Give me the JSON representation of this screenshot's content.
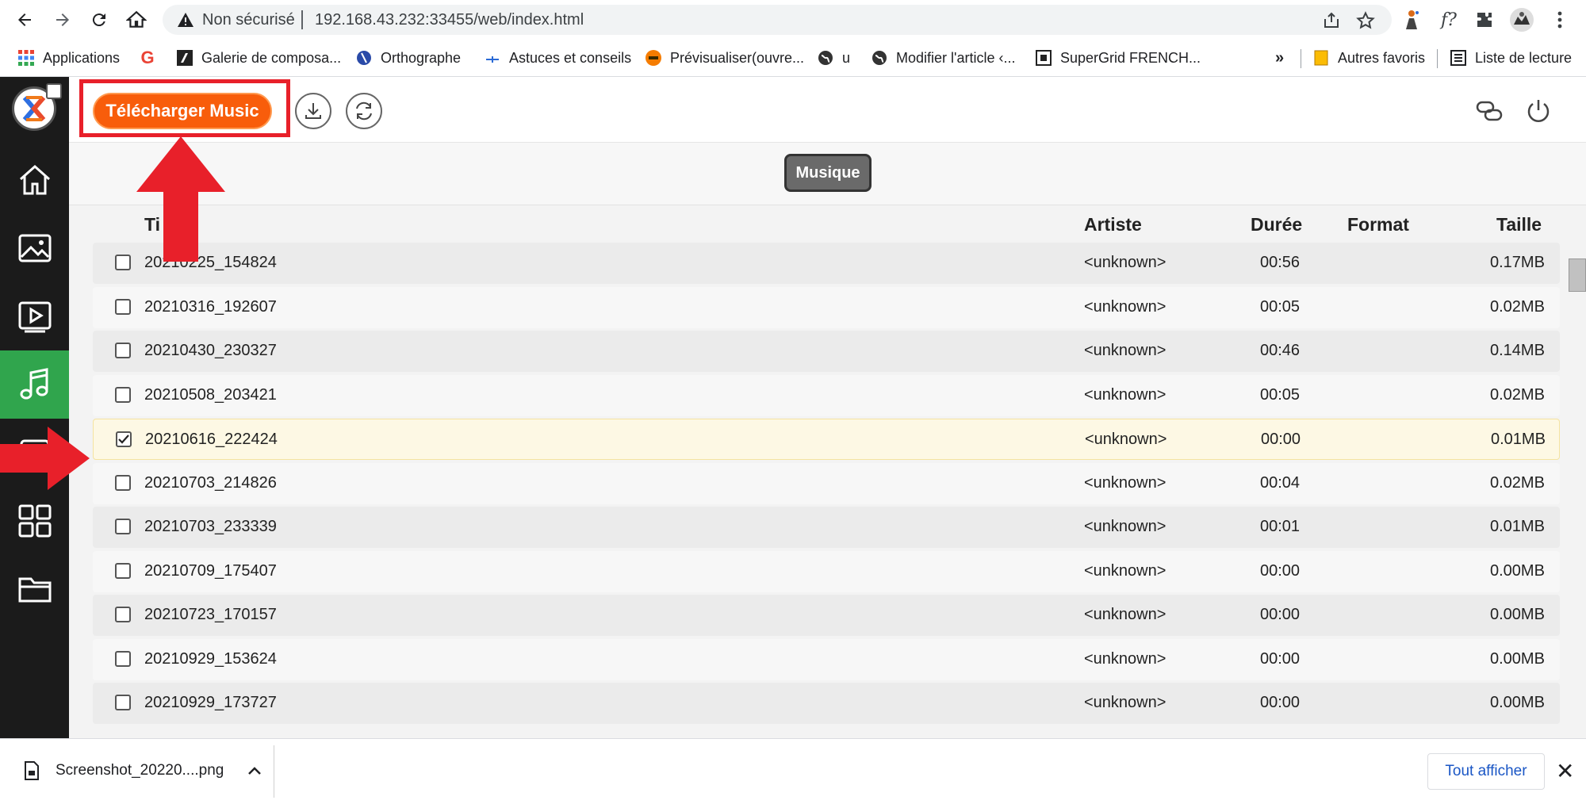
{
  "browser": {
    "security_label": "Non sécurisé",
    "url": "192.168.43.232:33455/web/index.html"
  },
  "bookmarks": [
    {
      "label": "Applications",
      "icon": "apps-grid-icon"
    },
    {
      "label": "",
      "icon": "google-icon"
    },
    {
      "label": "Galerie de composa...",
      "icon": "bookmark-page-icon"
    },
    {
      "label": "Orthographe",
      "icon": "bookmark-page-icon"
    },
    {
      "label": "Astuces et conseils",
      "icon": "bookmark-page-icon"
    },
    {
      "label": "Prévisualiser(ouvre...",
      "icon": "bookmark-page-icon"
    },
    {
      "label": "u",
      "icon": "globe-icon"
    },
    {
      "label": "Modifier l'article ‹...",
      "icon": "globe-icon"
    },
    {
      "label": "SuperGrid FRENCH...",
      "icon": "bookmark-page-icon"
    }
  ],
  "bookmarks_overflow": "»",
  "other_bookmarks": "Autres favoris",
  "reading_list": "Liste de lecture",
  "app": {
    "upload_button": "Télécharger Music",
    "category_tab": "Musique",
    "columns": {
      "title": "Titre",
      "title_visible": "Ti",
      "artist": "Artiste",
      "duration": "Durée",
      "format": "Format",
      "size": "Taille"
    },
    "rows": [
      {
        "name": "20210225_154824",
        "artist": "<unknown>",
        "duration": "00:56",
        "format": "",
        "size": "0.17MB",
        "checked": false
      },
      {
        "name": "20210316_192607",
        "artist": "<unknown>",
        "duration": "00:05",
        "format": "",
        "size": "0.02MB",
        "checked": false
      },
      {
        "name": "20210430_230327",
        "artist": "<unknown>",
        "duration": "00:46",
        "format": "",
        "size": "0.14MB",
        "checked": false
      },
      {
        "name": "20210508_203421",
        "artist": "<unknown>",
        "duration": "00:05",
        "format": "",
        "size": "0.02MB",
        "checked": false
      },
      {
        "name": "20210616_222424",
        "artist": "<unknown>",
        "duration": "00:00",
        "format": "",
        "size": "0.01MB",
        "checked": true
      },
      {
        "name": "20210703_214826",
        "artist": "<unknown>",
        "duration": "00:04",
        "format": "",
        "size": "0.02MB",
        "checked": false
      },
      {
        "name": "20210703_233339",
        "artist": "<unknown>",
        "duration": "00:01",
        "format": "",
        "size": "0.01MB",
        "checked": false
      },
      {
        "name": "20210709_175407",
        "artist": "<unknown>",
        "duration": "00:00",
        "format": "",
        "size": "0.00MB",
        "checked": false
      },
      {
        "name": "20210723_170157",
        "artist": "<unknown>",
        "duration": "00:00",
        "format": "",
        "size": "0.00MB",
        "checked": false
      },
      {
        "name": "20210929_153624",
        "artist": "<unknown>",
        "duration": "00:00",
        "format": "",
        "size": "0.00MB",
        "checked": false
      },
      {
        "name": "20210929_173727",
        "artist": "<unknown>",
        "duration": "00:00",
        "format": "",
        "size": "0.00MB",
        "checked": false
      }
    ]
  },
  "download_bar": {
    "file_name": "Screenshot_20220....png",
    "show_all": "Tout afficher"
  },
  "colors": {
    "upload_button": "#f85d0b",
    "sidebar_active": "#30a54d",
    "sidebar_bg": "#1b1b1b",
    "annotation_red": "#e8202a"
  }
}
